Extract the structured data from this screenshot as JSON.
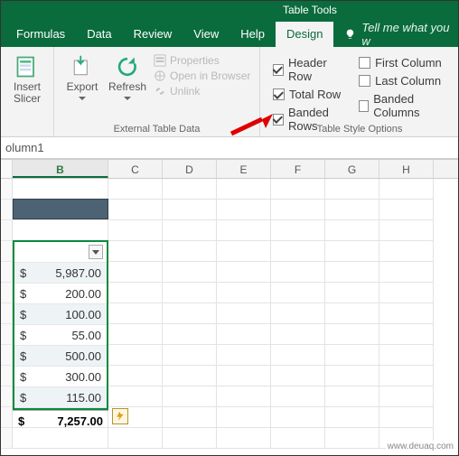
{
  "titlebar": {
    "tabletools": "Table Tools"
  },
  "tabs": {
    "formulas": "Formulas",
    "data": "Data",
    "review": "Review",
    "view": "View",
    "help": "Help",
    "design": "Design",
    "tellme": "Tell me what you w"
  },
  "ribbon": {
    "insert_slicer": "Insert\nSlicer",
    "export": "Export",
    "refresh": "Refresh",
    "properties": "Properties",
    "open_browser": "Open in Browser",
    "unlink": "Unlink",
    "group_external": "External Table Data",
    "options": {
      "header_row": {
        "label": "Header Row",
        "checked": true
      },
      "total_row": {
        "label": "Total Row",
        "checked": true
      },
      "banded_rows": {
        "label": "Banded Rows",
        "checked": true
      },
      "first_column": {
        "label": "First Column",
        "checked": false
      },
      "last_column": {
        "label": "Last Column",
        "checked": false
      },
      "banded_columns": {
        "label": "Banded Columns",
        "checked": false
      },
      "group_label": "Table Style Options"
    }
  },
  "namebox": {
    "value": "olumn1"
  },
  "columns": [
    "B",
    "C",
    "D",
    "E",
    "F",
    "G",
    "H"
  ],
  "table": {
    "currency": "$",
    "rows": [
      "5,987.00",
      "200.00",
      "100.00",
      "55.00",
      "500.00",
      "300.00",
      "115.00"
    ],
    "total": "7,257.00"
  },
  "caption": "www.deuaq.com"
}
